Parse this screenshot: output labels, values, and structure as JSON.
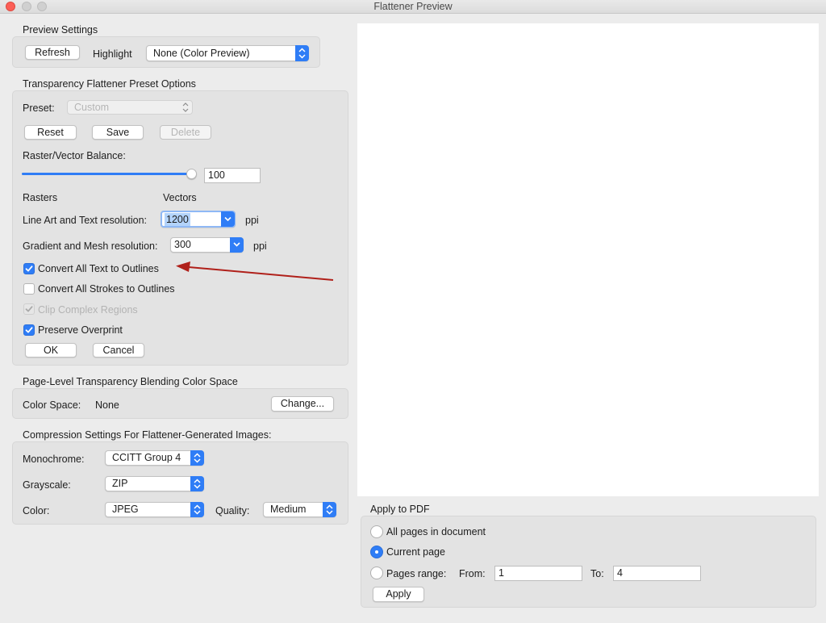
{
  "window": {
    "title": "Flattener Preview"
  },
  "preview_settings": {
    "section_title": "Preview Settings",
    "refresh_label": "Refresh",
    "highlight_label": "Highlight",
    "highlight_value": "None (Color Preview)"
  },
  "preset_options": {
    "section_title": "Transparency Flattener Preset Options",
    "preset_label": "Preset:",
    "preset_value": "Custom",
    "reset_label": "Reset",
    "save_label": "Save",
    "delete_label": "Delete",
    "balance_label": "Raster/Vector Balance:",
    "balance_value": "100",
    "balance_fraction": 1.0,
    "rasters_label": "Rasters",
    "vectors_label": "Vectors",
    "line_art_label": "Line Art and Text resolution:",
    "line_art_value": "1200",
    "gradient_label": "Gradient and Mesh resolution:",
    "gradient_value": "300",
    "ppi_label": "ppi",
    "checkboxes": [
      {
        "label": "Convert All Text to Outlines",
        "checked": true,
        "enabled": true
      },
      {
        "label": "Convert All Strokes to Outlines",
        "checked": false,
        "enabled": true
      },
      {
        "label": "Clip Complex Regions",
        "checked": true,
        "enabled": false
      },
      {
        "label": "Preserve Overprint",
        "checked": true,
        "enabled": true
      }
    ],
    "ok_label": "OK",
    "cancel_label": "Cancel"
  },
  "color_space": {
    "section_title": "Page-Level Transparency Blending Color Space",
    "label": "Color Space:",
    "value": "None",
    "change_label": "Change..."
  },
  "compression": {
    "section_title": "Compression Settings For Flattener-Generated Images:",
    "monochrome_label": "Monochrome:",
    "monochrome_value": "CCITT Group 4",
    "grayscale_label": "Grayscale:",
    "grayscale_value": "ZIP",
    "color_label": "Color:",
    "color_value": "JPEG",
    "quality_label": "Quality:",
    "quality_value": "Medium"
  },
  "apply_to_pdf": {
    "section_title": "Apply to PDF",
    "options": [
      {
        "label": "All pages in document",
        "selected": false
      },
      {
        "label": "Current page",
        "selected": true
      },
      {
        "label": "Pages range:",
        "selected": false
      }
    ],
    "from_label": "From:",
    "from_value": "1",
    "to_label": "To:",
    "to_value": "4",
    "apply_label": "Apply"
  },
  "colors": {
    "accent": "#2f7df6",
    "annotation_arrow": "#b0201a",
    "window_bg": "#ececec"
  }
}
